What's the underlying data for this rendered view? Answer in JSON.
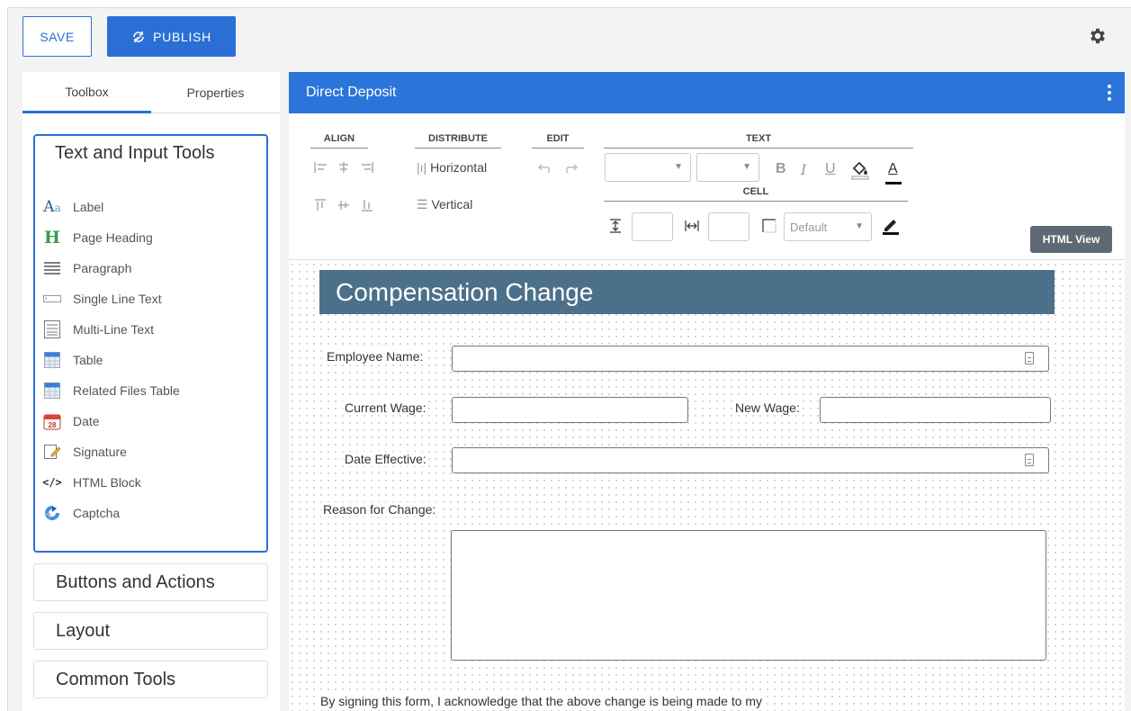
{
  "topbar": {
    "save_label": "SAVE",
    "publish_label": "PUBLISH"
  },
  "left_panel": {
    "tabs": [
      {
        "label": "Toolbox",
        "active": true
      },
      {
        "label": "Properties",
        "active": false
      }
    ],
    "tool_group": {
      "title": "Text and Input Tools",
      "items": [
        {
          "label": "Label",
          "icon": "label-icon"
        },
        {
          "label": "Page Heading",
          "icon": "heading-icon"
        },
        {
          "label": "Paragraph",
          "icon": "paragraph-icon"
        },
        {
          "label": "Single Line Text",
          "icon": "single-line-text-icon"
        },
        {
          "label": "Multi-Line Text",
          "icon": "multi-line-text-icon"
        },
        {
          "label": "Table",
          "icon": "table-icon"
        },
        {
          "label": "Related Files Table",
          "icon": "related-files-table-icon"
        },
        {
          "label": "Date",
          "icon": "calendar-icon"
        },
        {
          "label": "Signature",
          "icon": "signature-icon"
        },
        {
          "label": "HTML Block",
          "icon": "code-icon"
        },
        {
          "label": "Captcha",
          "icon": "captcha-icon"
        }
      ]
    },
    "sections": [
      "Buttons and Actions",
      "Layout",
      "Common Tools"
    ]
  },
  "form": {
    "title": "Direct Deposit",
    "toolbar": {
      "align_label": "ALIGN",
      "distribute_label": "DISTRIBUTE",
      "edit_label": "EDIT",
      "text_label": "TEXT",
      "cell_label": "CELL",
      "horizontal_label": "Horizontal",
      "vertical_label": "Vertical",
      "border_style": "Default",
      "html_view_label": "HTML View",
      "bold_glyph": "B",
      "italic_glyph": "I",
      "underline_glyph": "U",
      "font_color_glyph": "A"
    },
    "content": {
      "heading": "Compensation Change",
      "employee_name_label": "Employee Name:",
      "current_wage_label": "Current Wage:",
      "new_wage_label": "New Wage:",
      "date_effective_label": "Date Effective:",
      "reason_label": "Reason for Change:",
      "acknowledgement": "By signing this form, I acknowledge that the above change is being made to my"
    }
  },
  "colors": {
    "accent": "#2b6fd6",
    "header_blue": "#2b74d9",
    "heading_bg": "#4d708a",
    "html_view_bg": "#5d6975"
  }
}
